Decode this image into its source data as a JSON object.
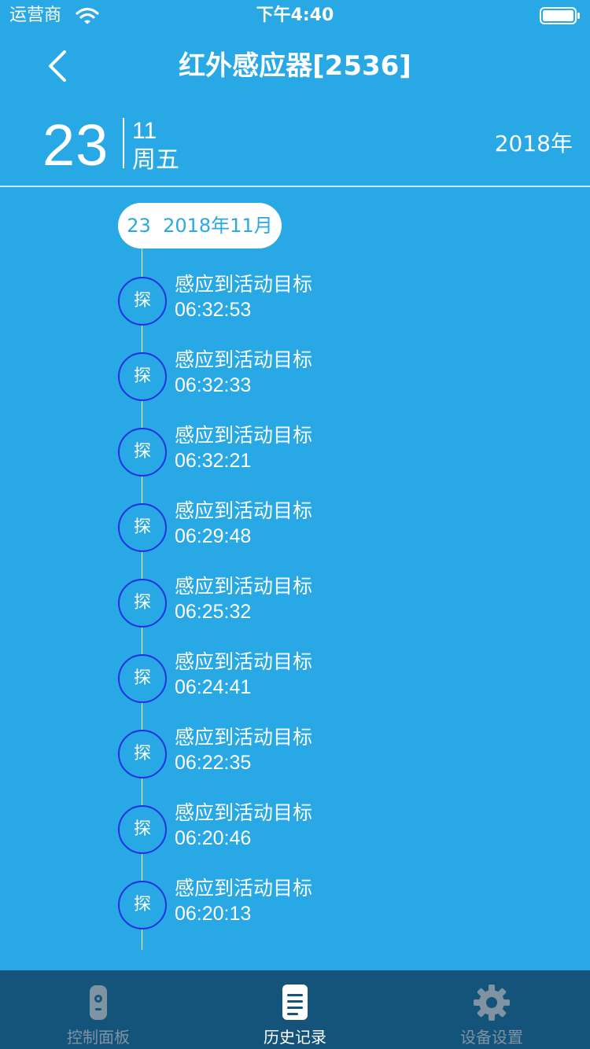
{
  "status_bar": {
    "carrier": "运营商",
    "time": "下午4:40"
  },
  "nav": {
    "title": "红外感应器[2536]",
    "back_icon": "chevron-left-icon"
  },
  "date_header": {
    "day": "23",
    "month": "11",
    "weekday": "周五",
    "year": "2018年"
  },
  "timeline": {
    "date_label": "23  2018年11月",
    "events": [
      {
        "badge": "探",
        "title": "感应到活动目标",
        "time": "06:32:53"
      },
      {
        "badge": "探",
        "title": "感应到活动目标",
        "time": "06:32:33"
      },
      {
        "badge": "探",
        "title": "感应到活动目标",
        "time": "06:32:21"
      },
      {
        "badge": "探",
        "title": "感应到活动目标",
        "time": "06:29:48"
      },
      {
        "badge": "探",
        "title": "感应到活动目标",
        "time": "06:25:32"
      },
      {
        "badge": "探",
        "title": "感应到活动目标",
        "time": "06:24:41"
      },
      {
        "badge": "探",
        "title": "感应到活动目标",
        "time": "06:22:35"
      },
      {
        "badge": "探",
        "title": "感应到活动目标",
        "time": "06:20:46"
      },
      {
        "badge": "探",
        "title": "感应到活动目标",
        "time": "06:20:13"
      }
    ]
  },
  "tab_bar": {
    "tabs": [
      {
        "label": "控制面板",
        "icon": "remote-control-icon",
        "active": false
      },
      {
        "label": "历史记录",
        "icon": "document-list-icon",
        "active": true
      },
      {
        "label": "设备设置",
        "icon": "gear-icon",
        "active": false
      }
    ]
  },
  "colors": {
    "background": "#29a8e6",
    "tab_bar": "#14537a",
    "badge_border": "#1e31e0",
    "tab_inactive": "#7f93a3",
    "tab_active": "#ffffff"
  }
}
